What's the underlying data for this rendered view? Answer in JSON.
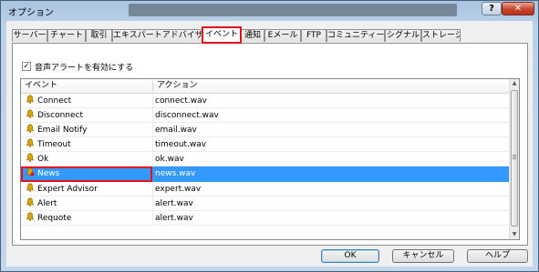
{
  "window": {
    "title": "オプション",
    "help_label": "?",
    "close_label": "✕"
  },
  "tabs": [
    "サーバー",
    "チャート",
    "取引",
    "エキスパートアドバイザ",
    "イベント",
    "通知",
    "Eメール",
    "FTP",
    "コミュニティー",
    "シグナル",
    "ストレージ"
  ],
  "active_tab": "イベント",
  "enable_sounds": {
    "label": "音声アラートを有効にする",
    "checked": true
  },
  "list": {
    "headers": {
      "event": "イベント",
      "action": "アクション"
    },
    "rows": [
      {
        "event": "Connect",
        "action": "connect.wav",
        "icon": "bell-icon"
      },
      {
        "event": "Disconnect",
        "action": "disconnect.wav",
        "icon": "bell-icon"
      },
      {
        "event": "Email Notify",
        "action": "email.wav",
        "icon": "bell-icon"
      },
      {
        "event": "Timeout",
        "action": "timeout.wav",
        "icon": "bell-icon"
      },
      {
        "event": "Ok",
        "action": "ok.wav",
        "icon": "bell-icon"
      },
      {
        "event": "News",
        "action": "news.wav",
        "icon": "bell-icon",
        "selected": true
      },
      {
        "event": "Expert Advisor",
        "action": "expert.wav",
        "icon": "bell-icon"
      },
      {
        "event": "Alert",
        "action": "alert.wav",
        "icon": "bell-icon"
      },
      {
        "event": "Requote",
        "action": "alert.wav",
        "icon": "bell-icon"
      }
    ]
  },
  "buttons": {
    "ok": "OK",
    "cancel": "キャンセル",
    "help": "ヘルプ"
  },
  "colors": {
    "selection": "#3399ff",
    "highlight": "#e0131b",
    "bell": "#d8a400"
  }
}
